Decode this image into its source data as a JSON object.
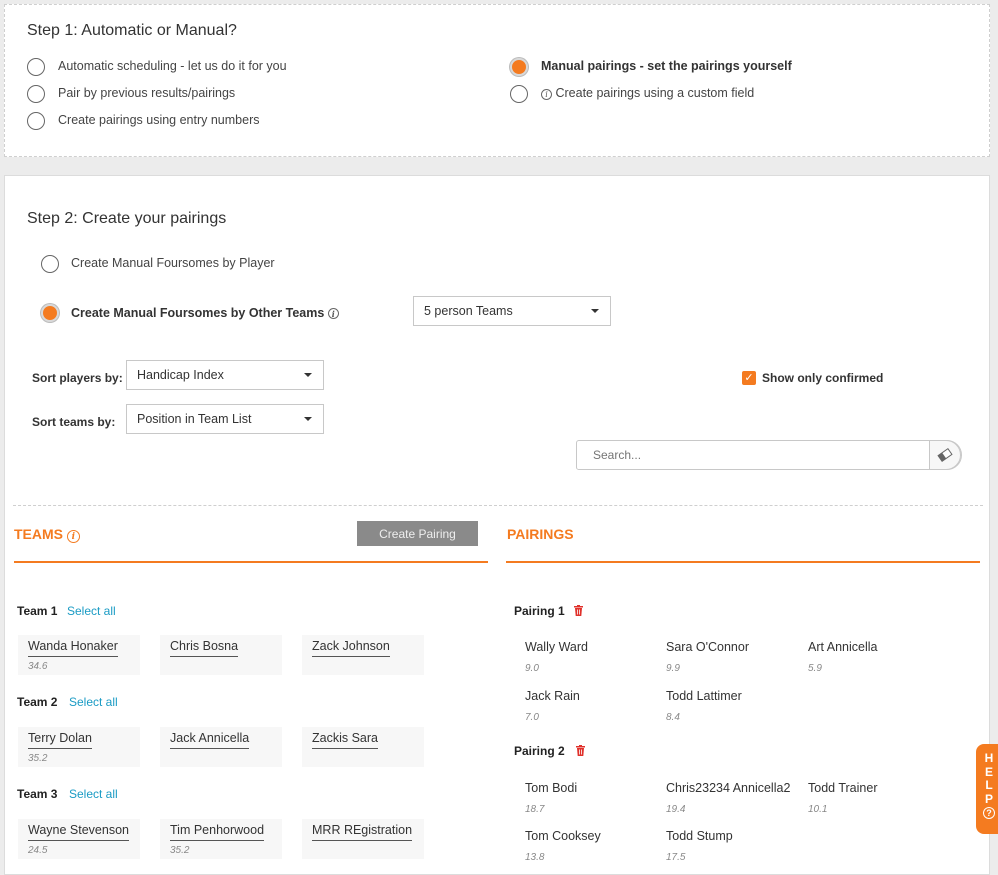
{
  "step1": {
    "title": "Step 1: Automatic or Manual?",
    "options": [
      {
        "label": "Automatic scheduling - let us do it for you",
        "selected": false
      },
      {
        "label": "Pair by previous results/pairings",
        "selected": false
      },
      {
        "label": "Create pairings using entry numbers",
        "selected": false
      },
      {
        "label": "Manual pairings - set the pairings yourself",
        "selected": true
      },
      {
        "label": "Create pairings using a custom field",
        "selected": false
      }
    ]
  },
  "step2": {
    "title": "Step 2: Create your pairings",
    "option_by_player": "Create Manual Foursomes by Player",
    "option_by_teams": "Create Manual Foursomes by Other Teams",
    "team_size_select": "5 person Teams",
    "sort_players_label": "Sort players by:",
    "sort_players_value": "Handicap Index",
    "sort_teams_label": "Sort teams by:",
    "sort_teams_value": "Position in Team List",
    "show_confirmed_label": "Show only confirmed",
    "show_confirmed_checked": true,
    "search_placeholder": "Search..."
  },
  "teams_panel": {
    "title": "TEAMS",
    "create_button": "Create Pairing",
    "select_all": "Select all",
    "teams": [
      {
        "name": "Team 1",
        "players": [
          {
            "name": "Wanda Honaker",
            "hcp": "34.6"
          },
          {
            "name": "Chris Bosna",
            "hcp": ""
          },
          {
            "name": "Zack Johnson",
            "hcp": ""
          }
        ]
      },
      {
        "name": "Team 2",
        "players": [
          {
            "name": "Terry Dolan",
            "hcp": "35.2"
          },
          {
            "name": "Jack Annicella",
            "hcp": ""
          },
          {
            "name": "Zackis Sara",
            "hcp": ""
          }
        ]
      },
      {
        "name": "Team 3",
        "players": [
          {
            "name": "Wayne Stevenson",
            "hcp": "24.5"
          },
          {
            "name": "Tim Penhorwood",
            "hcp": "35.2"
          },
          {
            "name": "MRR REgistration",
            "hcp": ""
          }
        ]
      }
    ]
  },
  "pairings_panel": {
    "title": "PAIRINGS",
    "pairings": [
      {
        "name": "Pairing 1",
        "members": [
          {
            "name": "Wally Ward",
            "hcp": "9.0"
          },
          {
            "name": "Sara O'Connor",
            "hcp": "9.9"
          },
          {
            "name": "Art Annicella",
            "hcp": "5.9"
          },
          {
            "name": "Jack Rain",
            "hcp": "7.0"
          },
          {
            "name": "Todd Lattimer",
            "hcp": "8.4"
          }
        ]
      },
      {
        "name": "Pairing 2",
        "members": [
          {
            "name": "Tom Bodi",
            "hcp": "18.7"
          },
          {
            "name": "Chris23234 Annicella2",
            "hcp": "19.4"
          },
          {
            "name": "Todd Trainer",
            "hcp": "10.1"
          },
          {
            "name": "Tom Cooksey",
            "hcp": "13.8"
          },
          {
            "name": "Todd Stump",
            "hcp": "17.5"
          }
        ]
      }
    ]
  },
  "help_tab": {
    "letters": [
      "H",
      "E",
      "L",
      "P"
    ],
    "icon": "?"
  },
  "colors": {
    "accent": "#f47b20",
    "link": "#1a9bc4",
    "delete": "#e0312b",
    "button_grey": "#8a8a8a"
  }
}
